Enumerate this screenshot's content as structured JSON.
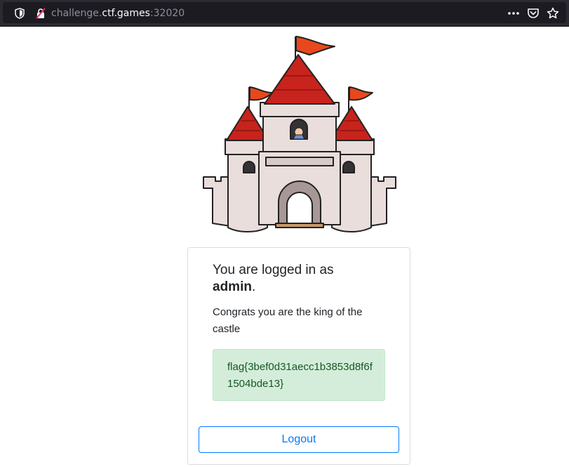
{
  "browser": {
    "url_prefix": "challenge.",
    "url_host": "ctf.games",
    "url_port": ":32020",
    "icons": [
      "shield-icon",
      "insecure-lock-icon",
      "more-actions-icon",
      "pocket-icon",
      "bookmark-star-icon"
    ]
  },
  "page": {
    "logo": "castle-image",
    "title_prefix": "You are logged in as",
    "username": "admin",
    "title_suffix": ".",
    "message": "Congrats you are the king of the castle",
    "flag": "flag{3bef0d31aecc1b3853d8f6f1504bde13}",
    "logout_label": "Logout"
  },
  "colors": {
    "flag_bg": "#d4edda",
    "flag_text": "#155724",
    "logout_border": "#007bff",
    "toolbar_bg": "#2b2a33"
  }
}
